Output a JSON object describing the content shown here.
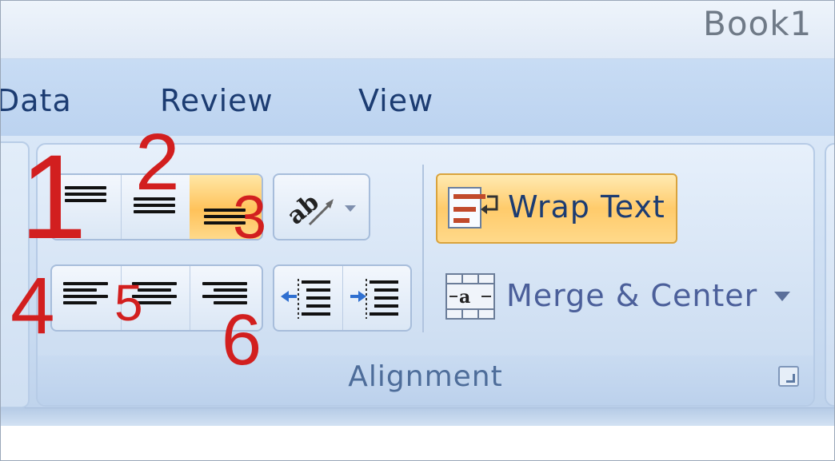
{
  "window": {
    "title": "Book1"
  },
  "tabs": [
    {
      "label": "Data"
    },
    {
      "label": "Review"
    },
    {
      "label": "View"
    }
  ],
  "alignment_group": {
    "label": "Alignment",
    "wrap_text_label": "Wrap Text",
    "merge_center_label": "Merge & Center"
  },
  "annotations": [
    "1",
    "2",
    "3",
    "4",
    "5",
    "6"
  ],
  "colors": {
    "annotation": "#d21f1f",
    "active_button": "#ffc25a",
    "tab_text": "#1c3c72"
  },
  "icons": {
    "top_align": "align-top-icon",
    "middle_align": "align-middle-icon",
    "bottom_align": "align-bottom-icon",
    "orientation": "text-orientation-icon",
    "left_align": "align-left-icon",
    "center_align": "align-center-icon",
    "right_align": "align-right-icon",
    "decrease_indent": "decrease-indent-icon",
    "increase_indent": "increase-indent-icon",
    "wrap_text": "wrap-text-icon",
    "merge_center": "merge-center-icon"
  }
}
